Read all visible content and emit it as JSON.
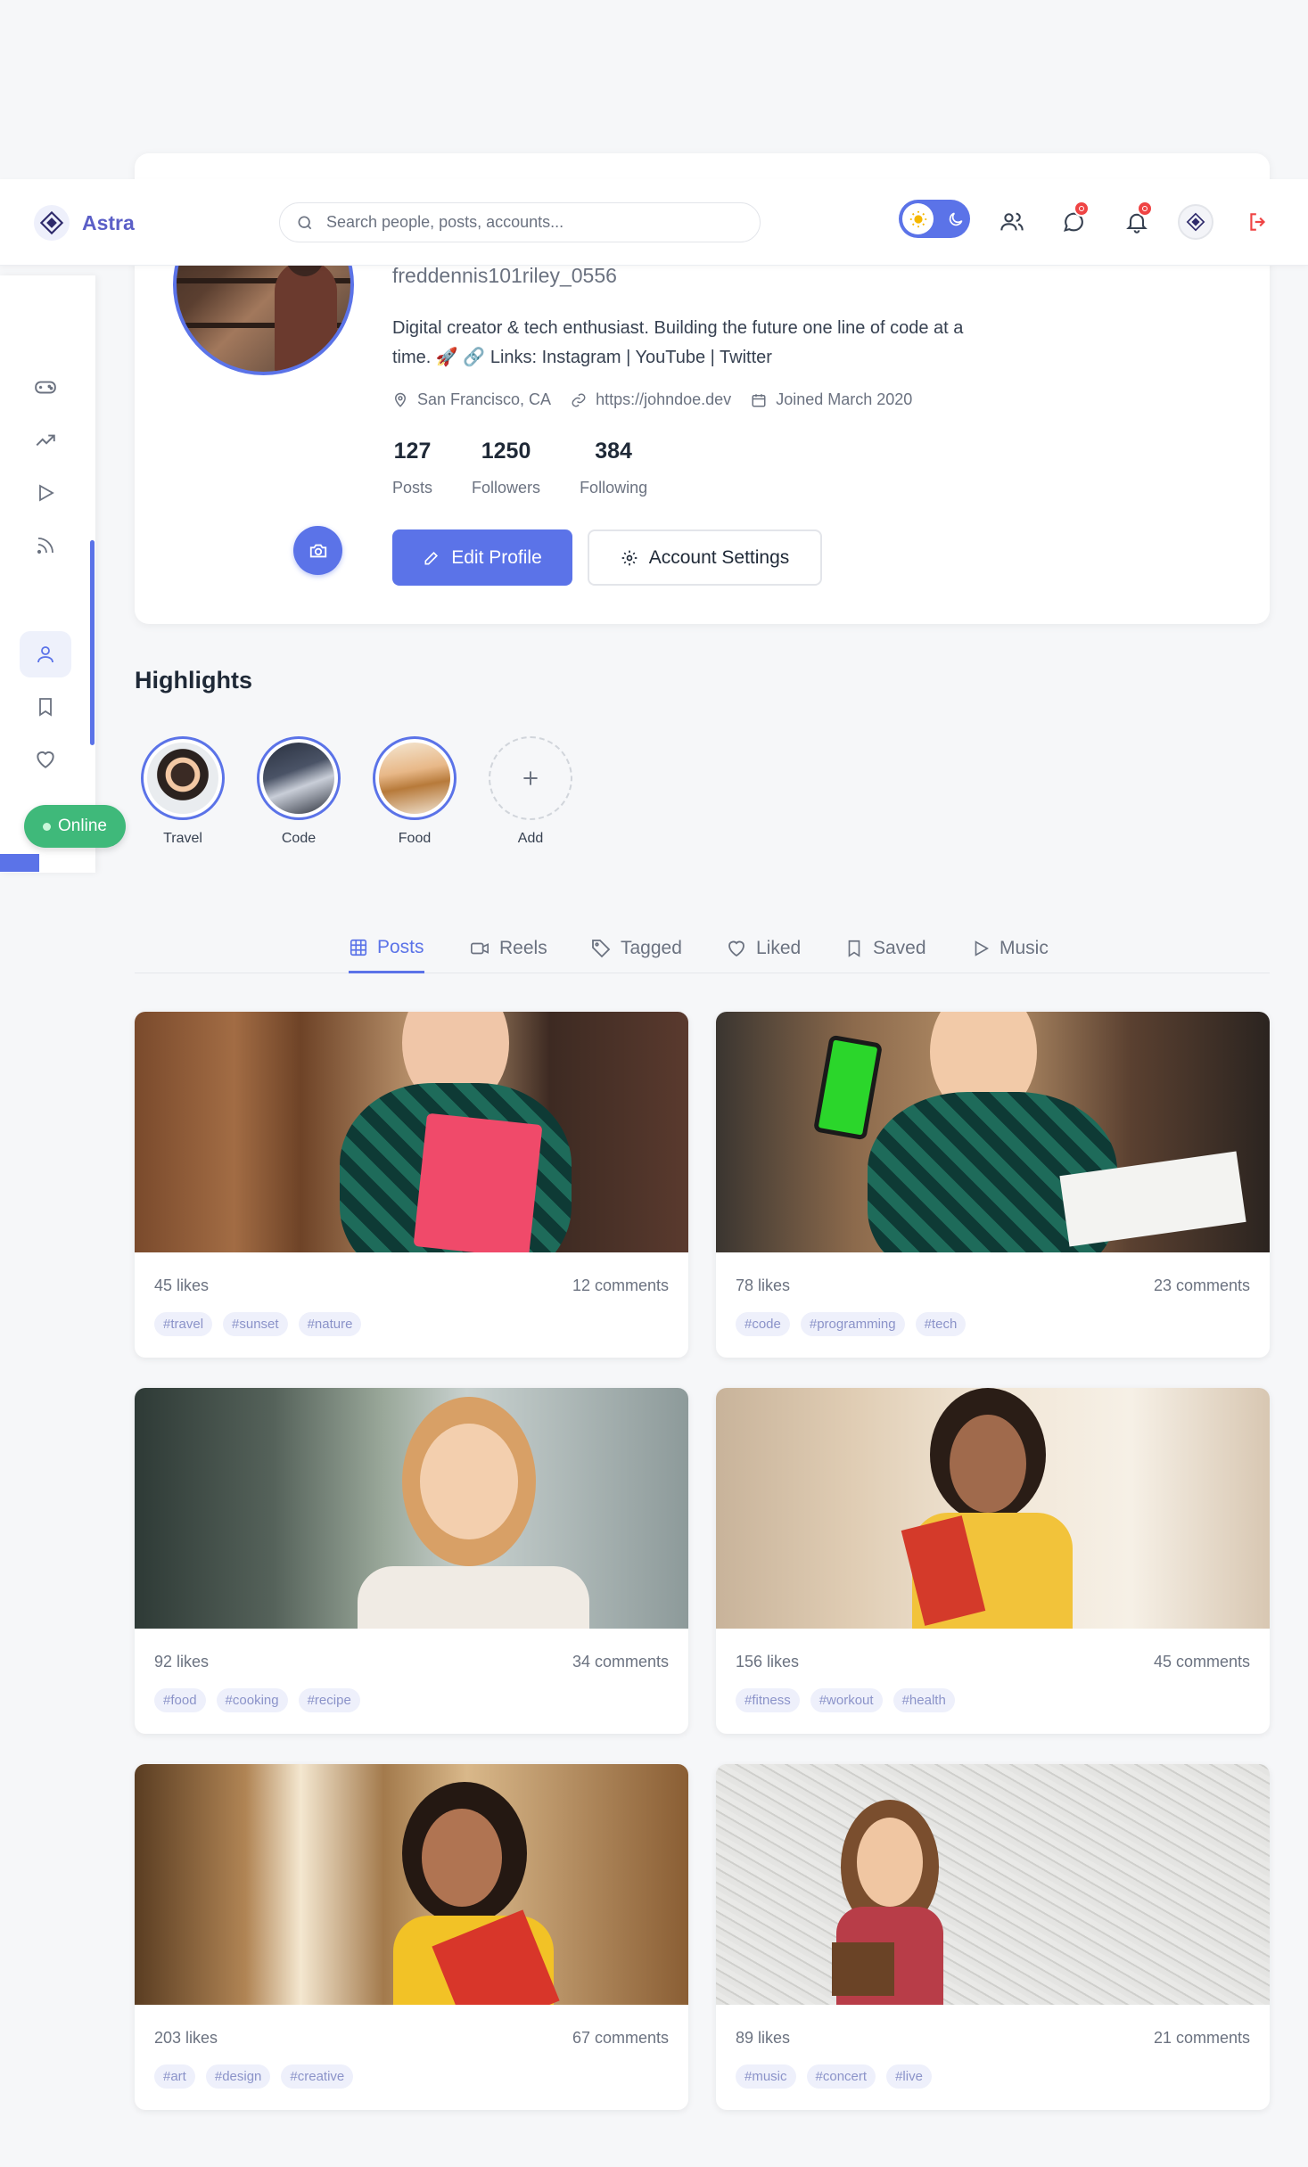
{
  "app": {
    "name": "Astra"
  },
  "search": {
    "placeholder": "Search people, posts, accounts..."
  },
  "colors": {
    "accent": "#5b73e8",
    "online": "#3fb97a",
    "badge": "#ef4444",
    "logout": "#ef4444"
  },
  "nav_icons": [
    "users-icon",
    "messages-icon",
    "bell-icon",
    "astra-avatar-icon",
    "logout-icon"
  ],
  "sidebar": {
    "items": [
      "gamepad-icon",
      "trending-icon",
      "play-icon",
      "feed-icon",
      "user-icon",
      "bookmark-icon",
      "heart-icon"
    ],
    "active": "user-icon",
    "status": "Online"
  },
  "profile": {
    "username": "freddennis101riley_0556",
    "bio": "Digital creator & tech enthusiast. Building the future one line of code at a time. 🚀 🔗 Links: Instagram | YouTube | Twitter",
    "location": "San Francisco, CA",
    "website": "https://johndoe.dev",
    "joined": "Joined March 2020",
    "stats": [
      {
        "value": "127",
        "label": "Posts"
      },
      {
        "value": "1250",
        "label": "Followers"
      },
      {
        "value": "384",
        "label": "Following"
      }
    ],
    "edit_label": "Edit Profile",
    "settings_label": "Account Settings"
  },
  "highlights": {
    "title": "Highlights",
    "items": [
      {
        "label": "Travel"
      },
      {
        "label": "Code"
      },
      {
        "label": "Food"
      },
      {
        "label": "Add"
      }
    ]
  },
  "tabs": [
    {
      "label": "Posts",
      "icon": "grid-icon",
      "active": true
    },
    {
      "label": "Reels",
      "icon": "video-icon"
    },
    {
      "label": "Tagged",
      "icon": "tag-icon"
    },
    {
      "label": "Liked",
      "icon": "heart-icon"
    },
    {
      "label": "Saved",
      "icon": "bookmark-icon"
    },
    {
      "label": "Music",
      "icon": "play-icon"
    }
  ],
  "posts": [
    {
      "likes": "45 likes",
      "comments": "12 comments",
      "tags": [
        "#travel",
        "#sunset",
        "#nature"
      ]
    },
    {
      "likes": "78 likes",
      "comments": "23 comments",
      "tags": [
        "#code",
        "#programming",
        "#tech"
      ]
    },
    {
      "likes": "92 likes",
      "comments": "34 comments",
      "tags": [
        "#food",
        "#cooking",
        "#recipe"
      ]
    },
    {
      "likes": "156 likes",
      "comments": "45 comments",
      "tags": [
        "#fitness",
        "#workout",
        "#health"
      ]
    },
    {
      "likes": "203 likes",
      "comments": "67 comments",
      "tags": [
        "#art",
        "#design",
        "#creative"
      ]
    },
    {
      "likes": "89 likes",
      "comments": "21 comments",
      "tags": [
        "#music",
        "#concert",
        "#live"
      ]
    }
  ]
}
